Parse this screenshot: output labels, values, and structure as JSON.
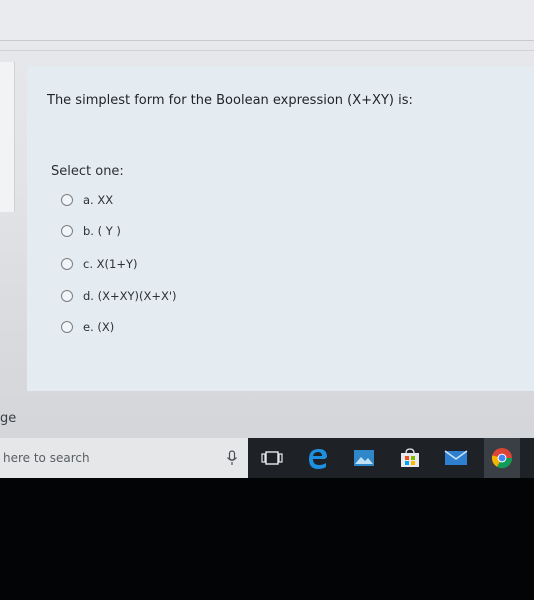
{
  "quiz": {
    "question": "The simplest form for the Boolean expression (X+XY) is:",
    "select_label": "Select one:",
    "options": [
      {
        "label": "a. XX"
      },
      {
        "label": "b. ( Y )"
      },
      {
        "label": "c. X(1+Y)"
      },
      {
        "label": "d. (X+XY)(X+X')"
      },
      {
        "label": "e. (X)"
      }
    ]
  },
  "side_label": "ge",
  "taskbar": {
    "search_placeholder": "here to search",
    "icons": [
      "microphone-icon",
      "task-view-icon",
      "edge-icon",
      "photos-icon",
      "store-icon",
      "mail-icon",
      "chrome-icon"
    ]
  },
  "colors": {
    "card_background": "#e4ecf2",
    "taskbar": "#1e2227",
    "edge_blue": "#1e90e0"
  }
}
